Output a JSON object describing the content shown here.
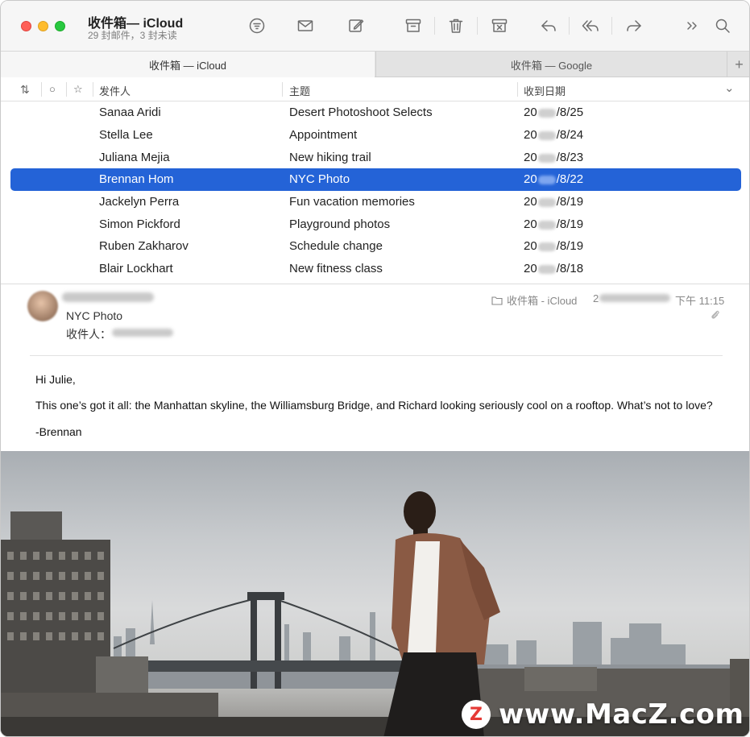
{
  "window": {
    "title": "收件箱— iCloud",
    "subtitle": "29 封邮件，3 封未读"
  },
  "toolbar": {
    "buttons": [
      "filter-icon",
      "envelope-icon",
      "compose-icon",
      "archive-icon",
      "trash-icon",
      "junk-icon",
      "reply-icon",
      "reply-all-icon",
      "forward-icon",
      "more-icon",
      "search-icon"
    ]
  },
  "tabs": {
    "active": "收件箱 — iCloud",
    "inactive": "收件箱 — Google",
    "add": "+"
  },
  "columns": {
    "sort_icon": "⇅",
    "unread_icon": "○",
    "flag_icon": "☆",
    "from": "发件人",
    "subject": "主题",
    "date": "收到日期",
    "chevron": "⌄"
  },
  "messages": [
    {
      "from": "Sanaa Aridi",
      "subject": "Desert Photoshoot Selects",
      "date_prefix": "20",
      "date_suffix": "/8/25",
      "selected": false
    },
    {
      "from": "Stella Lee",
      "subject": "Appointment",
      "date_prefix": "20",
      "date_suffix": "/8/24",
      "selected": false
    },
    {
      "from": "Juliana Mejia",
      "subject": "New hiking trail",
      "date_prefix": "20",
      "date_suffix": "/8/23",
      "selected": false
    },
    {
      "from": "Brennan Hom",
      "subject": "NYC Photo",
      "date_prefix": "20",
      "date_suffix": "/8/22",
      "selected": true
    },
    {
      "from": "Jackelyn Perra",
      "subject": "Fun vacation memories",
      "date_prefix": "20",
      "date_suffix": "/8/19",
      "selected": false
    },
    {
      "from": "Simon Pickford",
      "subject": "Playground photos",
      "date_prefix": "20",
      "date_suffix": "/8/19",
      "selected": false
    },
    {
      "from": "Ruben Zakharov",
      "subject": "Schedule change",
      "date_prefix": "20",
      "date_suffix": "/8/19",
      "selected": false
    },
    {
      "from": "Blair Lockhart",
      "subject": "New fitness class",
      "date_prefix": "20",
      "date_suffix": "/8/18",
      "selected": false
    }
  ],
  "message": {
    "subject": "NYC Photo",
    "to_label": "收件人：",
    "mailbox": "收件箱 - iCloud",
    "date_prefix": "2",
    "time": "下午 11:15",
    "body": [
      "Hi Julie,",
      "This one’s got it all: the Manhattan skyline, the Williamsburg Bridge, and Richard looking seriously cool on a rooftop. What’s not to love?",
      "-Brennan"
    ]
  },
  "watermark": {
    "logo": "Z",
    "text": "www.MacZ.com"
  }
}
